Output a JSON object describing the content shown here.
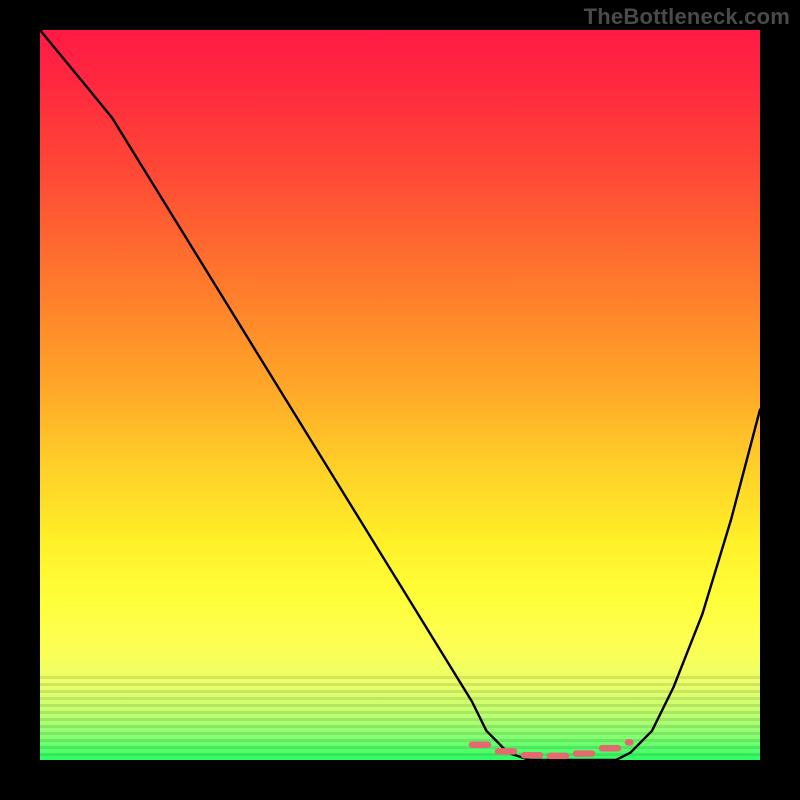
{
  "watermark": "TheBottleneck.com",
  "chart_data": {
    "type": "line",
    "title": "",
    "xlabel": "",
    "ylabel": "",
    "xlim": [
      0,
      100
    ],
    "ylim": [
      0,
      100
    ],
    "grid": false,
    "background": "rainbow-gradient (red top → green bottom)",
    "series": [
      {
        "name": "bottleneck-curve",
        "x": [
          0,
          5,
          10,
          15,
          20,
          25,
          30,
          35,
          40,
          45,
          50,
          55,
          60,
          62,
          65,
          68,
          72,
          76,
          80,
          82,
          85,
          88,
          92,
          96,
          100
        ],
        "y": [
          100,
          94,
          88,
          80,
          72,
          64,
          56,
          48,
          40,
          32,
          24,
          16,
          8,
          4,
          1,
          0,
          0,
          0,
          0,
          1,
          4,
          10,
          20,
          33,
          48
        ]
      }
    ],
    "optimal_band": {
      "name": "optimal-region-dashes",
      "x_start": 60,
      "x_end": 82,
      "y": 0
    },
    "gradient_stops": [
      {
        "pct": 0,
        "color": "#ff1a45"
      },
      {
        "pct": 20,
        "color": "#ff4a35"
      },
      {
        "pct": 40,
        "color": "#ff8a2a"
      },
      {
        "pct": 60,
        "color": "#ffd028"
      },
      {
        "pct": 78,
        "color": "#ffff3a"
      },
      {
        "pct": 90,
        "color": "#e8ff6a"
      },
      {
        "pct": 100,
        "color": "#2cff64"
      }
    ]
  }
}
